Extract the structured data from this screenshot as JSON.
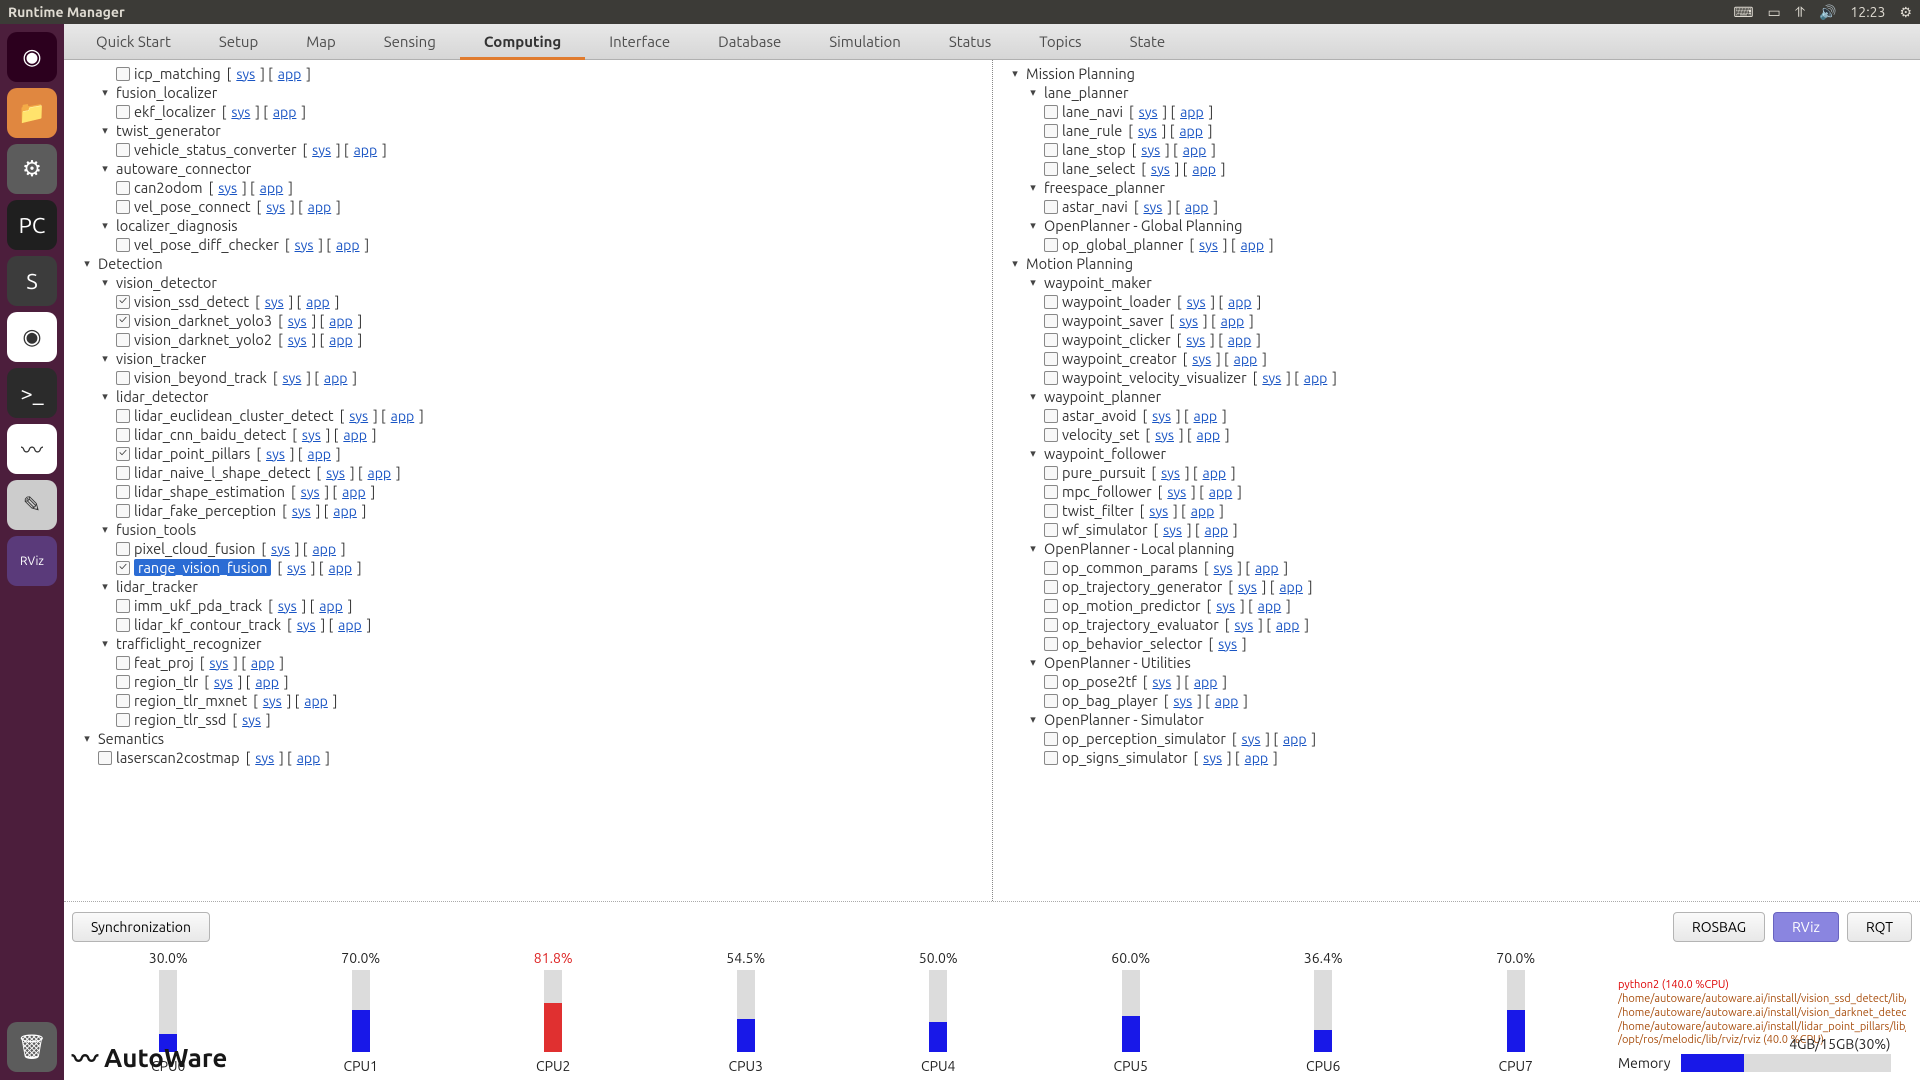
{
  "window": {
    "title": "Runtime Manager"
  },
  "topbar": {
    "time": "12:23"
  },
  "tabs": [
    "Quick Start",
    "Setup",
    "Map",
    "Sensing",
    "Computing",
    "Interface",
    "Database",
    "Simulation",
    "Status",
    "Topics",
    "State"
  ],
  "active_tab": "Computing",
  "link_labels": {
    "sys": "sys",
    "app": "app"
  },
  "launcher": [
    {
      "name": "dash",
      "bg": "#2c001e",
      "icon": "◉"
    },
    {
      "name": "files",
      "bg": "#e08740",
      "icon": "📁"
    },
    {
      "name": "settings",
      "bg": "#5c5c5c",
      "icon": "⚙"
    },
    {
      "name": "pycharm",
      "bg": "#1f1f1f",
      "icon": "PC"
    },
    {
      "name": "sublime",
      "bg": "#3c3c3c",
      "icon": "S"
    },
    {
      "name": "chrome",
      "bg": "#fff",
      "icon": "◉"
    },
    {
      "name": "terminal",
      "bg": "#2b2b2b",
      "icon": ">_"
    },
    {
      "name": "autoware",
      "bg": "#ffffff",
      "icon": "〰"
    },
    {
      "name": "editor",
      "bg": "#cccccc",
      "icon": "✎"
    },
    {
      "name": "rviz",
      "bg": "#5a3a7a",
      "icon": "RViz"
    }
  ],
  "trash": {
    "name": "trash",
    "bg": "#5c5c5c",
    "icon": "🗑"
  },
  "left_tree": [
    {
      "type": "leaf",
      "indent": 2,
      "label": "icp_matching",
      "checked": false,
      "links": true
    },
    {
      "type": "group",
      "indent": 1,
      "label": "fusion_localizer"
    },
    {
      "type": "leaf",
      "indent": 2,
      "label": "ekf_localizer",
      "checked": false,
      "links": true
    },
    {
      "type": "group",
      "indent": 1,
      "label": "twist_generator"
    },
    {
      "type": "leaf",
      "indent": 2,
      "label": "vehicle_status_converter",
      "checked": false,
      "links": true
    },
    {
      "type": "group",
      "indent": 1,
      "label": "autoware_connector"
    },
    {
      "type": "leaf",
      "indent": 2,
      "label": "can2odom",
      "checked": false,
      "links": true
    },
    {
      "type": "leaf",
      "indent": 2,
      "label": "vel_pose_connect",
      "checked": false,
      "links": true
    },
    {
      "type": "group",
      "indent": 1,
      "label": "localizer_diagnosis"
    },
    {
      "type": "leaf",
      "indent": 2,
      "label": "vel_pose_diff_checker",
      "checked": false,
      "links": true
    },
    {
      "type": "group",
      "indent": 0,
      "label": "Detection"
    },
    {
      "type": "group",
      "indent": 1,
      "label": "vision_detector"
    },
    {
      "type": "leaf",
      "indent": 2,
      "label": "vision_ssd_detect",
      "checked": true,
      "links": true
    },
    {
      "type": "leaf",
      "indent": 2,
      "label": "vision_darknet_yolo3",
      "checked": true,
      "links": true
    },
    {
      "type": "leaf",
      "indent": 2,
      "label": "vision_darknet_yolo2",
      "checked": false,
      "links": true
    },
    {
      "type": "group",
      "indent": 1,
      "label": "vision_tracker"
    },
    {
      "type": "leaf",
      "indent": 2,
      "label": "vision_beyond_track",
      "checked": false,
      "links": true
    },
    {
      "type": "group",
      "indent": 1,
      "label": "lidar_detector"
    },
    {
      "type": "leaf",
      "indent": 2,
      "label": "lidar_euclidean_cluster_detect",
      "checked": false,
      "links": true
    },
    {
      "type": "leaf",
      "indent": 2,
      "label": "lidar_cnn_baidu_detect",
      "checked": false,
      "links": true
    },
    {
      "type": "leaf",
      "indent": 2,
      "label": "lidar_point_pillars",
      "checked": true,
      "links": true
    },
    {
      "type": "leaf",
      "indent": 2,
      "label": "lidar_naive_l_shape_detect",
      "checked": false,
      "links": true
    },
    {
      "type": "leaf",
      "indent": 2,
      "label": "lidar_shape_estimation",
      "checked": false,
      "links": true
    },
    {
      "type": "leaf",
      "indent": 2,
      "label": "lidar_fake_perception",
      "checked": false,
      "links": true
    },
    {
      "type": "group",
      "indent": 1,
      "label": "fusion_tools"
    },
    {
      "type": "leaf",
      "indent": 2,
      "label": "pixel_cloud_fusion",
      "checked": false,
      "links": true
    },
    {
      "type": "leaf",
      "indent": 2,
      "label": "range_vision_fusion",
      "checked": true,
      "links": true,
      "highlighted": true
    },
    {
      "type": "group",
      "indent": 1,
      "label": "lidar_tracker"
    },
    {
      "type": "leaf",
      "indent": 2,
      "label": "imm_ukf_pda_track",
      "checked": false,
      "links": true
    },
    {
      "type": "leaf",
      "indent": 2,
      "label": "lidar_kf_contour_track",
      "checked": false,
      "links": true
    },
    {
      "type": "group",
      "indent": 1,
      "label": "trafficlight_recognizer"
    },
    {
      "type": "leaf",
      "indent": 2,
      "label": "feat_proj",
      "checked": false,
      "links": true
    },
    {
      "type": "leaf",
      "indent": 2,
      "label": "region_tlr",
      "checked": false,
      "links": true
    },
    {
      "type": "leaf",
      "indent": 2,
      "label": "region_tlr_mxnet",
      "checked": false,
      "links": true
    },
    {
      "type": "leaf",
      "indent": 2,
      "label": "region_tlr_ssd",
      "checked": false,
      "links": true,
      "no_app": true
    },
    {
      "type": "group",
      "indent": 0,
      "label": "Semantics"
    },
    {
      "type": "leaf",
      "indent": 1,
      "label": "laserscan2costmap",
      "checked": false,
      "links": true
    }
  ],
  "right_tree": [
    {
      "type": "group",
      "indent": 0,
      "label": "Mission Planning"
    },
    {
      "type": "group",
      "indent": 1,
      "label": "lane_planner"
    },
    {
      "type": "leaf",
      "indent": 2,
      "label": "lane_navi",
      "checked": false,
      "links": true
    },
    {
      "type": "leaf",
      "indent": 2,
      "label": "lane_rule",
      "checked": false,
      "links": true
    },
    {
      "type": "leaf",
      "indent": 2,
      "label": "lane_stop",
      "checked": false,
      "links": true
    },
    {
      "type": "leaf",
      "indent": 2,
      "label": "lane_select",
      "checked": false,
      "links": true
    },
    {
      "type": "group",
      "indent": 1,
      "label": "freespace_planner"
    },
    {
      "type": "leaf",
      "indent": 2,
      "label": "astar_navi",
      "checked": false,
      "links": true
    },
    {
      "type": "group",
      "indent": 1,
      "label": "OpenPlanner - Global Planning"
    },
    {
      "type": "leaf",
      "indent": 2,
      "label": "op_global_planner",
      "checked": false,
      "links": true
    },
    {
      "type": "group",
      "indent": 0,
      "label": "Motion Planning"
    },
    {
      "type": "group",
      "indent": 1,
      "label": "waypoint_maker"
    },
    {
      "type": "leaf",
      "indent": 2,
      "label": "waypoint_loader",
      "checked": false,
      "links": true
    },
    {
      "type": "leaf",
      "indent": 2,
      "label": "waypoint_saver",
      "checked": false,
      "links": true
    },
    {
      "type": "leaf",
      "indent": 2,
      "label": "waypoint_clicker",
      "checked": false,
      "links": true
    },
    {
      "type": "leaf",
      "indent": 2,
      "label": "waypoint_creator",
      "checked": false,
      "links": true
    },
    {
      "type": "leaf",
      "indent": 2,
      "label": "waypoint_velocity_visualizer",
      "checked": false,
      "links": true
    },
    {
      "type": "group",
      "indent": 1,
      "label": "waypoint_planner"
    },
    {
      "type": "leaf",
      "indent": 2,
      "label": "astar_avoid",
      "checked": false,
      "links": true
    },
    {
      "type": "leaf",
      "indent": 2,
      "label": "velocity_set",
      "checked": false,
      "links": true
    },
    {
      "type": "group",
      "indent": 1,
      "label": "waypoint_follower"
    },
    {
      "type": "leaf",
      "indent": 2,
      "label": "pure_pursuit",
      "checked": false,
      "links": true
    },
    {
      "type": "leaf",
      "indent": 2,
      "label": "mpc_follower",
      "checked": false,
      "links": true
    },
    {
      "type": "leaf",
      "indent": 2,
      "label": "twist_filter",
      "checked": false,
      "links": true
    },
    {
      "type": "leaf",
      "indent": 2,
      "label": "wf_simulator",
      "checked": false,
      "links": true
    },
    {
      "type": "group",
      "indent": 1,
      "label": "OpenPlanner - Local planning"
    },
    {
      "type": "leaf",
      "indent": 2,
      "label": "op_common_params",
      "checked": false,
      "links": true
    },
    {
      "type": "leaf",
      "indent": 2,
      "label": "op_trajectory_generator",
      "checked": false,
      "links": true
    },
    {
      "type": "leaf",
      "indent": 2,
      "label": "op_motion_predictor",
      "checked": false,
      "links": true
    },
    {
      "type": "leaf",
      "indent": 2,
      "label": "op_trajectory_evaluator",
      "checked": false,
      "links": true
    },
    {
      "type": "leaf",
      "indent": 2,
      "label": "op_behavior_selector",
      "checked": false,
      "links": true,
      "no_app": true
    },
    {
      "type": "group",
      "indent": 1,
      "label": "OpenPlanner - Utilities"
    },
    {
      "type": "leaf",
      "indent": 2,
      "label": "op_pose2tf",
      "checked": false,
      "links": true
    },
    {
      "type": "leaf",
      "indent": 2,
      "label": "op_bag_player",
      "checked": false,
      "links": true
    },
    {
      "type": "group",
      "indent": 1,
      "label": "OpenPlanner - Simulator"
    },
    {
      "type": "leaf",
      "indent": 2,
      "label": "op_perception_simulator",
      "checked": false,
      "links": true
    },
    {
      "type": "leaf",
      "indent": 2,
      "label": "op_signs_simulator",
      "checked": false,
      "links": true
    }
  ],
  "sync_button": "Synchronization",
  "right_buttons": [
    "ROSBAG",
    "RViz",
    "RQT"
  ],
  "right_button_active": 1,
  "cpus": [
    {
      "name": "CPU0",
      "pct": 30.0
    },
    {
      "name": "CPU1",
      "pct": 70.0
    },
    {
      "name": "CPU2",
      "pct": 81.8,
      "hot": true
    },
    {
      "name": "CPU3",
      "pct": 54.5
    },
    {
      "name": "CPU4",
      "pct": 50.0
    },
    {
      "name": "CPU5",
      "pct": 60.0
    },
    {
      "name": "CPU6",
      "pct": 36.4
    },
    {
      "name": "CPU7",
      "pct": 70.0
    }
  ],
  "procs": [
    {
      "text": "python2 (140.0 %CPU)",
      "red": true
    },
    {
      "text": "/home/autoware/autoware.ai/install/vision_ssd_detect/lib/vision_ss"
    },
    {
      "text": "/home/autoware/autoware.ai/install/vision_darknet_detect/lib/visio"
    },
    {
      "text": "/home/autoware/autoware.ai/install/lidar_point_pillars/lib/lidar_poi"
    },
    {
      "text": "/opt/ros/melodic/lib/rviz/rviz (40.0 %CPU)"
    }
  ],
  "memory": {
    "label": "Memory",
    "text": "4GB/15GB(30%)",
    "pct": 30
  },
  "logo": "AutoWare"
}
